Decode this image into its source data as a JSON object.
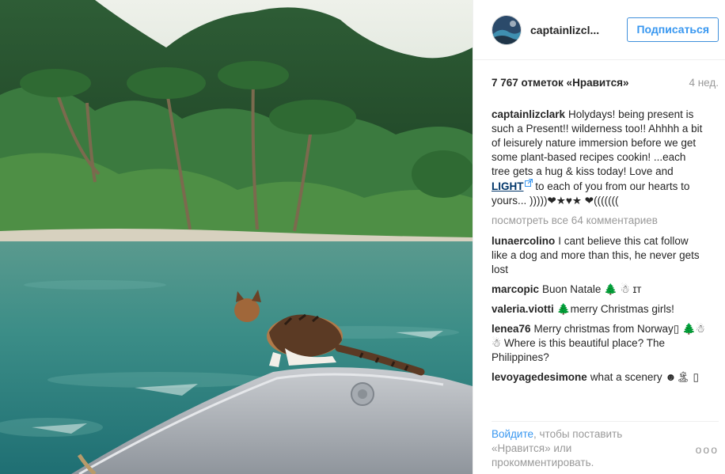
{
  "owner": {
    "username": "captainlizcl...",
    "follow_label": "Подписаться"
  },
  "stats": {
    "likes": "7 767 отметок «Нравится»",
    "age": "4 нед."
  },
  "caption": {
    "username": "captainlizclark",
    "text_before": "Holydays! being present is such a Present!! wilderness too!! Ahhhh a bit of leisurely nature immersion before we get some plant-based recipes cookin! ...each tree gets a hug & kiss today! Love and",
    "tag": "LIGHT",
    "text_after": "to each of you from our hearts to yours... )))))❤★♥★ ❤((((((("
  },
  "view_all": "посмотреть все 64 комментариев",
  "comments": [
    {
      "user": "lunaercolino",
      "text": "I cant believe this cat follow like a dog and more than this, he never gets lost"
    },
    {
      "user": "marcopic",
      "text": "Buon Natale 🌲 ☃ ɪᴛ"
    },
    {
      "user": "valeria.viotti",
      "text": "🌲merry Christmas girls!"
    },
    {
      "user": "lenea76",
      "text": "Merry christmas from Norway▯ 🌲☃☃ Where is this beautiful place? The Philippines?"
    },
    {
      "user": "levoyagedesimone",
      "text": "what a scenery ☻🏝 ▯"
    }
  ],
  "footer": {
    "login_link": "Войдите",
    "text": ", чтобы поставить «Нравится» или прокомментировать.",
    "more_label": "ооо"
  },
  "icons": {
    "external": "external-link-icon",
    "more": "more-options-icon"
  },
  "colors": {
    "link": "#3897f0",
    "tag": "#003569",
    "muted": "#999999"
  }
}
